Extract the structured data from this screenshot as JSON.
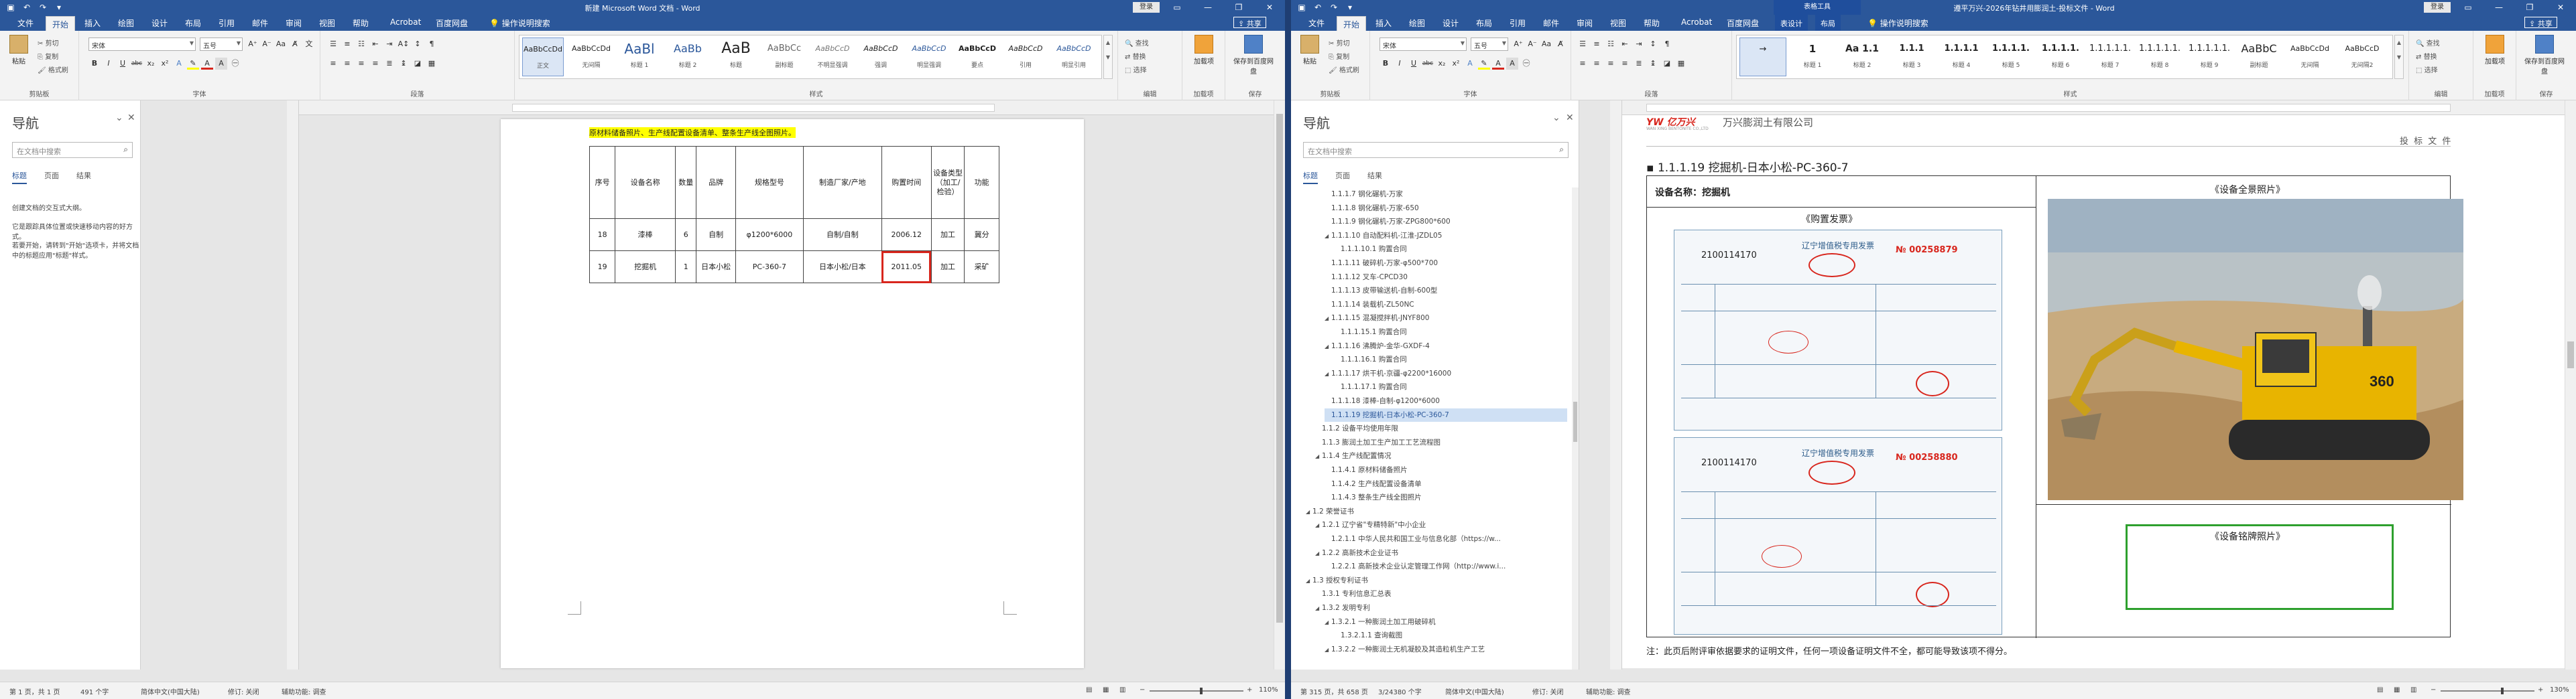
{
  "left_window": {
    "title": "新建 Microsoft Word 文档 - Word",
    "signin": "登录",
    "share": "共享",
    "tabs": [
      "文件",
      "开始",
      "插入",
      "绘图",
      "设计",
      "布局",
      "引用",
      "邮件",
      "审阅",
      "视图",
      "帮助",
      "Acrobat",
      "百度网盘"
    ],
    "tell_me": "操作说明搜索",
    "ribbon": {
      "clipboard": {
        "paste": "粘贴",
        "cut": "剪切",
        "copy": "复制",
        "format_painter": "格式刷",
        "label": "剪贴板"
      },
      "font": {
        "name": "宋体",
        "size": "五号",
        "label": "字体",
        "bold": "B",
        "italic": "I",
        "underline": "U",
        "strike": "abc",
        "sub": "x₂",
        "sup": "x²"
      },
      "paragraph": {
        "label": "段落"
      },
      "styles": {
        "label": "样式",
        "items": [
          {
            "preview": "AaBbCcDd",
            "name": "正文"
          },
          {
            "preview": "AaBbCcDd",
            "name": "无间隔"
          },
          {
            "preview": "AaBl",
            "name": "标题 1"
          },
          {
            "preview": "AaBb",
            "name": "标题 2"
          },
          {
            "preview": "AaB",
            "name": "标题"
          },
          {
            "preview": "AaBbCc",
            "name": "副标题"
          },
          {
            "preview": "AaBbCcD",
            "name": "不明显强调"
          },
          {
            "preview": "AaBbCcD",
            "name": "强调"
          },
          {
            "preview": "AaBbCcD",
            "name": "明显强调"
          },
          {
            "preview": "AaBbCcD",
            "name": "要点"
          },
          {
            "preview": "AaBbCcD",
            "name": "引用"
          },
          {
            "preview": "AaBbCcD",
            "name": "明显引用"
          }
        ]
      },
      "editing": {
        "find": "查找",
        "replace": "替换",
        "select": "选择",
        "label": "编辑"
      },
      "addins": {
        "label": "加载项",
        "name": "加载项"
      },
      "save": {
        "label": "保存",
        "name": "保存到百度网盘"
      }
    },
    "nav": {
      "title": "导航",
      "search_placeholder": "在文档中搜索",
      "tabs": [
        "标题",
        "页面",
        "结果"
      ],
      "msg1": "创建文档的交互式大纲。",
      "msg2": "它是跟踪具体位置或快速移动内容的好方式。",
      "msg3": "若要开始，请转到\"开始\"选项卡，并将文档中的标题应用\"标题\"样式。"
    },
    "doc": {
      "highlight": "原材料储备照片、生产线配置设备清单、整条生产线全图照片。",
      "table_headers": [
        "序号",
        "设备名称",
        "数量",
        "品牌",
        "规格型号",
        "制造厂家/产地",
        "购置时间",
        "设备类型（加工/检验）",
        "功能"
      ],
      "rows": [
        [
          "18",
          "漆棒",
          "6",
          "自制",
          "φ1200*6000",
          "自制/自制",
          "2006.12",
          "加工",
          "冀分"
        ],
        [
          "19",
          "挖掘机",
          "1",
          "日本小松",
          "PC-360-7",
          "日本小松/日本",
          "2011.05",
          "加工",
          "采矿"
        ]
      ]
    },
    "status": {
      "page": "第 1 页，共 1 页",
      "words": "491 个字",
      "lang": "简体中文(中国大陆)",
      "track": "修订: 关闭",
      "access": "辅助功能: 调查",
      "zoom": "110%"
    }
  },
  "right_window": {
    "title": "遵平万兴-2026年钻井用膨润土-投标文件 - Word",
    "context_tab_group": "表格工具",
    "signin": "登录",
    "share": "共享",
    "tabs": [
      "文件",
      "开始",
      "插入",
      "绘图",
      "设计",
      "布局",
      "引用",
      "邮件",
      "审阅",
      "视图",
      "帮助",
      "Acrobat",
      "百度网盘",
      "表设计",
      "布局"
    ],
    "tell_me": "操作说明搜索",
    "ribbon": {
      "clipboard": {
        "paste": "粘贴",
        "cut": "剪切",
        "copy": "复制",
        "format_painter": "格式刷",
        "label": "剪贴板"
      },
      "font": {
        "name": "宋体",
        "size": "五号",
        "label": "字体"
      },
      "paragraph": {
        "label": "段落"
      },
      "styles": {
        "label": "样式",
        "items": [
          {
            "preview": "→",
            "name": ""
          },
          {
            "preview": "1",
            "name": "标题 1"
          },
          {
            "preview": "Aa 1.1",
            "name": "标题 2"
          },
          {
            "preview": "1.1.1",
            "name": "标题 3"
          },
          {
            "preview": "1.1.1.1",
            "name": "标题 4"
          },
          {
            "preview": "1.1.1.1.",
            "name": "标题 5"
          },
          {
            "preview": "1.1.1.1.",
            "name": "标题 6"
          },
          {
            "preview": "1.1.1.1.1.",
            "name": "标题 7"
          },
          {
            "preview": "1.1.1.1.1.",
            "name": "标题 8"
          },
          {
            "preview": "1.1.1.1.1.",
            "name": "标题 9"
          },
          {
            "preview": "AaBbC",
            "name": "副标题"
          },
          {
            "preview": "AaBbCcDd",
            "name": "无间隔"
          },
          {
            "preview": "AaBbCcD",
            "name": "无间隔2"
          }
        ]
      },
      "editing": {
        "find": "查找",
        "replace": "替换",
        "select": "选择",
        "label": "编辑"
      },
      "addins": {
        "label": "加载项",
        "name": "加载项"
      },
      "save": {
        "label": "保存",
        "name": "保存到百度网盘"
      }
    },
    "nav": {
      "title": "导航",
      "search_placeholder": "在文档中搜索",
      "tabs": [
        "标题",
        "页面",
        "结果"
      ],
      "items": [
        {
          "text": "1.1.1.7 钢化碾机-万家",
          "level": 4,
          "arrow": ""
        },
        {
          "text": "1.1.1.8 钢化碾机-万家-650",
          "level": 4,
          "arrow": ""
        },
        {
          "text": "1.1.1.9 钢化碾机-万家-ZPG800*600",
          "level": 4,
          "arrow": ""
        },
        {
          "text": "1.1.1.10 自动配料机-江淮-JZDL05",
          "level": 4,
          "arrow": "◢"
        },
        {
          "text": "1.1.1.10.1 购置合同",
          "level": 5,
          "arrow": ""
        },
        {
          "text": "1.1.1.11 破碎机-万家-φ500*700",
          "level": 4,
          "arrow": ""
        },
        {
          "text": "1.1.1.12 叉车-CPCD30",
          "level": 4,
          "arrow": ""
        },
        {
          "text": "1.1.1.13 皮带输送机-自制-600型",
          "level": 4,
          "arrow": ""
        },
        {
          "text": "1.1.1.14 装载机-ZL50NC",
          "level": 4,
          "arrow": ""
        },
        {
          "text": "1.1.1.15 混凝搅拌机-JNYF800",
          "level": 4,
          "arrow": "◢"
        },
        {
          "text": "1.1.1.15.1 购置合同",
          "level": 5,
          "arrow": ""
        },
        {
          "text": "1.1.1.16 沸腾炉-金华-GXDF-4",
          "level": 4,
          "arrow": "◢"
        },
        {
          "text": "1.1.1.16.1 购置合同",
          "level": 5,
          "arrow": ""
        },
        {
          "text": "1.1.1.17 烘干机-京疆-φ2200*16000",
          "level": 4,
          "arrow": "◢"
        },
        {
          "text": "1.1.1.17.1 购置合同",
          "level": 5,
          "arrow": ""
        },
        {
          "text": "1.1.1.18 漆棒-自制-φ1200*6000",
          "level": 4,
          "arrow": ""
        },
        {
          "text": "1.1.1.19 挖掘机-日本小松-PC-360-7",
          "level": 4,
          "arrow": "",
          "current": true
        },
        {
          "text": "1.1.2 设备平均使用年限",
          "level": 3,
          "arrow": ""
        },
        {
          "text": "1.1.3 膨润土加工生产加工工艺流程图",
          "level": 3,
          "arrow": ""
        },
        {
          "text": "1.1.4 生产线配置情况",
          "level": 3,
          "arrow": "◢"
        },
        {
          "text": "1.1.4.1 原材料储备照片",
          "level": 4,
          "arrow": ""
        },
        {
          "text": "1.1.4.2 生产线配置设备清单",
          "level": 4,
          "arrow": ""
        },
        {
          "text": "1.1.4.3 整条生产线全图照片",
          "level": 4,
          "arrow": ""
        },
        {
          "text": "1.2 荣誉证书",
          "level": 2,
          "arrow": "◢"
        },
        {
          "text": "1.2.1 辽宁省\"专精特新\"中小企业",
          "level": 3,
          "arrow": "◢"
        },
        {
          "text": "1.2.1.1 中华人民共和国工业与信息化部（https://w...",
          "level": 4,
          "arrow": ""
        },
        {
          "text": "1.2.2 高新技术企业证书",
          "level": 3,
          "arrow": "◢"
        },
        {
          "text": "1.2.2.1 高新技术企业认定管理工作网（http://www.i...",
          "level": 4,
          "arrow": ""
        },
        {
          "text": "1.3 授权专利证书",
          "level": 2,
          "arrow": "◢"
        },
        {
          "text": "1.3.1 专利信息汇总表",
          "level": 3,
          "arrow": ""
        },
        {
          "text": "1.3.2 发明专利",
          "level": 3,
          "arrow": "◢"
        },
        {
          "text": "1.3.2.1 一种膨润土加工用破碎机",
          "level": 4,
          "arrow": "◢"
        },
        {
          "text": "1.3.2.1.1 查询截图",
          "level": 5,
          "arrow": ""
        },
        {
          "text": "1.3.2.2 一种膨润土无机凝胶及其造粒机生产工艺",
          "level": 4,
          "arrow": "◢"
        }
      ]
    },
    "doc": {
      "company": "万兴膨润土有限公司",
      "logo_text": "YW 亿万兴",
      "logo_sub": "WAN XING BENTONITE CO.,LTD",
      "header_right": "投 标 文 件",
      "heading": "1.1.1.19 挖掘机-日本小松-PC-360-7",
      "device_name": "设备名称：挖掘机",
      "purchase_invoice": "《购置发票》",
      "full_photo": "《设备全景照片》",
      "nameplate": "《设备铭牌照片》",
      "invoice1": {
        "code": "2100114170",
        "title": "辽宁增值税专用发票",
        "no": "№ 00258879"
      },
      "invoice2": {
        "code": "2100114170",
        "title": "辽宁增值税专用发票",
        "no": "№ 00258880"
      },
      "note": "注：此页后附评审依据要求的证明文件，任何一项设备证明文件不全，都可能导致该项不得分。"
    },
    "status": {
      "page": "第 315 页，共 658 页",
      "words": "3/24380 个字",
      "lang": "简体中文(中国大陆)",
      "track": "修订: 关闭",
      "access": "辅助功能: 调查",
      "zoom": "130%"
    }
  },
  "colors": {
    "word_blue": "#2b579a",
    "highlight": "#ffff00",
    "red_box": "#d8261d",
    "green_box": "#2ea02e",
    "excavator_yellow": "#e8b400"
  }
}
